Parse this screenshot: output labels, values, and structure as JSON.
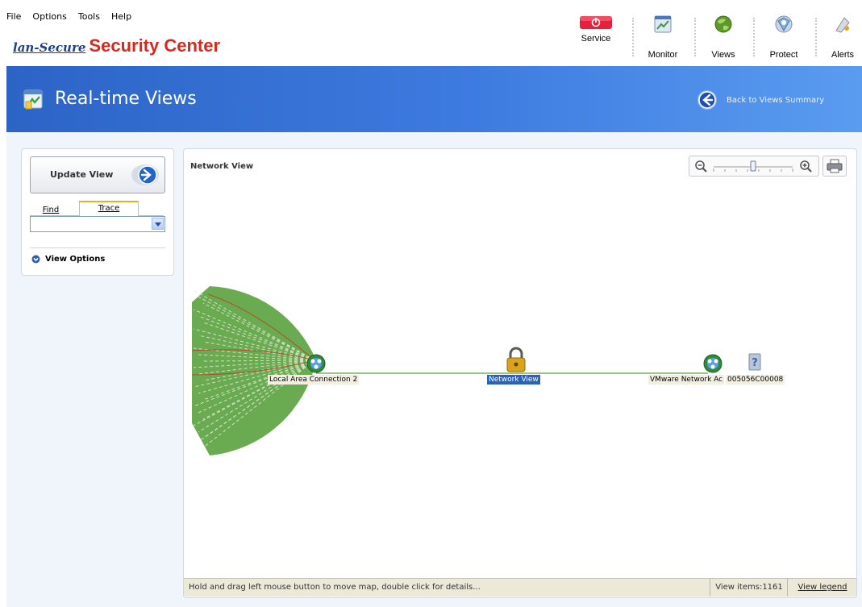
{
  "menu": [
    "File",
    "Options",
    "Tools",
    "Help"
  ],
  "brand": {
    "prefix": "lan-Secure",
    "name": "Security Center"
  },
  "toolbar": {
    "service": "Service",
    "monitor": "Monitor",
    "views": "Views",
    "protect": "Protect",
    "alerts": "Alerts"
  },
  "header": {
    "title": "Real-time Views",
    "back_link": "Back to Views Summary"
  },
  "left_panel": {
    "update_button": "Update View",
    "tab_find": "Find",
    "tab_trace": "Trace",
    "trace_value": "",
    "view_options": "View Options"
  },
  "main_panel": {
    "title": "Network View",
    "zoom_level": 0.5,
    "nodes": {
      "lan": "Local Area Connection 2",
      "center": "Network View",
      "vmware": "VMware Network Ac",
      "unknown": "005056C00008"
    }
  },
  "status": {
    "message": "Hold and drag left mouse button to move map, double click for details...",
    "items": "View items:1161",
    "legend": "View legend"
  },
  "colors": {
    "accent_blue": "#2c64c6",
    "brand_red": "#d8281d",
    "fan_green": "#6aaa50",
    "link_green": "#5aa040",
    "selected": "#2a62b8"
  }
}
